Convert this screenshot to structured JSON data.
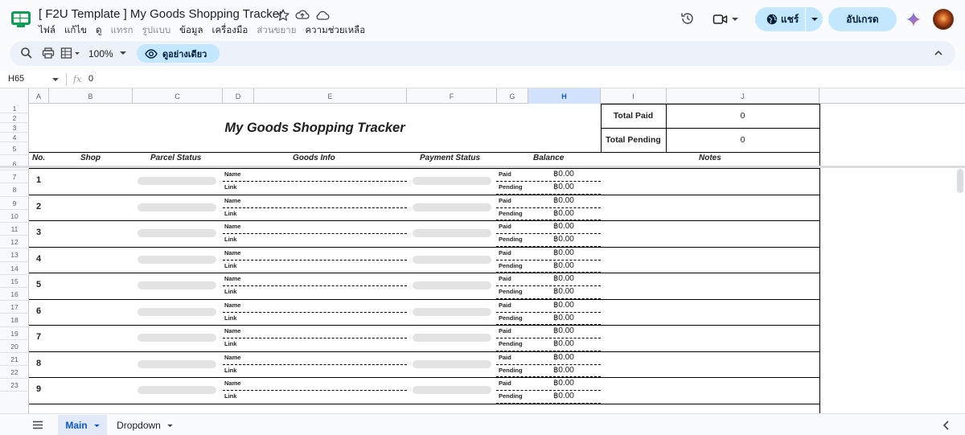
{
  "titlebar": {
    "doc_title": "[ F2U Template ] My Goods Shopping Tracker",
    "menu": [
      "ไฟล์",
      "แก้ไข",
      "ดู",
      "แทรก",
      "รูปแบบ",
      "ข้อมูล",
      "เครื่องมือ",
      "ส่วนขยาย",
      "ความช่วยเหลือ"
    ],
    "menu_disabled": [
      3,
      4,
      7
    ],
    "share_label": "แชร์",
    "upgrade_label": "อัปเกรด"
  },
  "toolbar": {
    "zoom": "100%",
    "view_only_label": "ดูอย่างเดียว"
  },
  "formula_bar": {
    "cell_ref": "H65",
    "fx": "fx",
    "value": "0"
  },
  "columns": [
    "A",
    "B",
    "C",
    "D",
    "E",
    "F",
    "G",
    "H",
    "I",
    "J"
  ],
  "selected_column": "H",
  "rows": [
    "1",
    "2",
    "3",
    "4",
    "5",
    "6",
    "7",
    "8",
    "9",
    "10",
    "11",
    "12",
    "13",
    "14",
    "15",
    "16",
    "17",
    "18",
    "19",
    "20",
    "21",
    "22",
    "23"
  ],
  "tracker": {
    "title": "My Goods Shopping Tracker",
    "total_paid_label": "Total Paid",
    "total_paid_value": "0",
    "total_pending_label": "Total Pending",
    "total_pending_value": "0",
    "headers": {
      "no": "No.",
      "shop": "Shop",
      "parcel_status": "Parcel Status",
      "goods_info": "Goods Info",
      "payment_status": "Payment Status",
      "balance": "Balance",
      "notes": "Notes"
    },
    "labels": {
      "name": "Name",
      "link": "Link",
      "paid": "Paid",
      "pending": "Pending"
    },
    "items": [
      {
        "no": "1",
        "paid": "฿0.00",
        "pending": "฿0.00"
      },
      {
        "no": "2",
        "paid": "฿0.00",
        "pending": "฿0.00"
      },
      {
        "no": "3",
        "paid": "฿0.00",
        "pending": "฿0.00"
      },
      {
        "no": "4",
        "paid": "฿0.00",
        "pending": "฿0.00"
      },
      {
        "no": "5",
        "paid": "฿0.00",
        "pending": "฿0.00"
      },
      {
        "no": "6",
        "paid": "฿0.00",
        "pending": "฿0.00"
      },
      {
        "no": "7",
        "paid": "฿0.00",
        "pending": "฿0.00"
      },
      {
        "no": "8",
        "paid": "฿0.00",
        "pending": "฿0.00"
      },
      {
        "no": "9",
        "paid": "฿0.00",
        "pending": "฿0.00"
      }
    ]
  },
  "tabs": {
    "active": "Main",
    "other": "Dropdown"
  },
  "colors": {
    "accent": "#c2e7ff",
    "selected_header": "#d3e3fd",
    "pill": "#e3e3e3",
    "logo_green": "#0f9d58"
  }
}
